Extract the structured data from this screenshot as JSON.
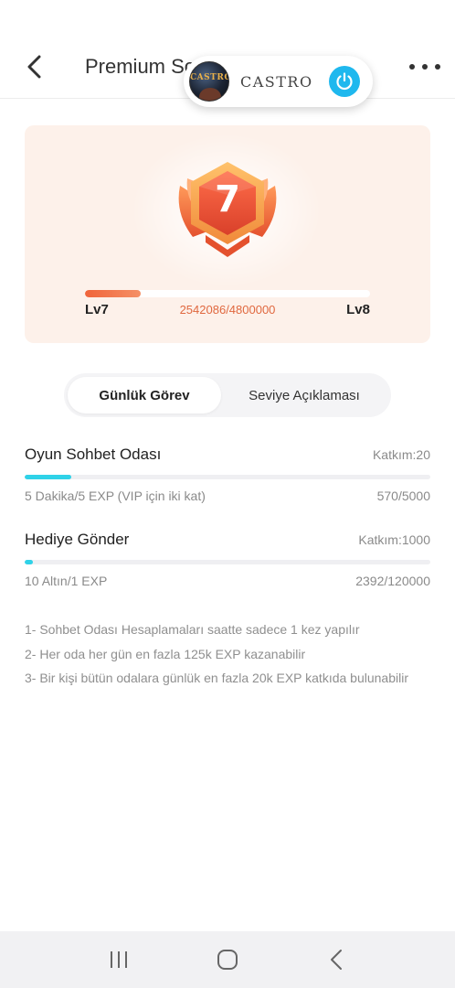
{
  "header": {
    "title": "Premium So",
    "overlay": {
      "brand": "CASTRO",
      "avatar_text": "CASTRO"
    }
  },
  "level_card": {
    "badge_level": "7",
    "current_level": "Lv7",
    "next_level": "Lv8",
    "progress_text": "2542086/4800000",
    "progress_fraction": 0.196,
    "accent_color": "#f0643a"
  },
  "tabs": [
    {
      "label": "Günlük Görev",
      "active": true
    },
    {
      "label": "Seviye Açıklaması",
      "active": false
    }
  ],
  "tasks": [
    {
      "title": "Oyun Sohbet Odası",
      "contribution": "Katkım:20",
      "description": "5 Dakika/5 EXP (VIP için iki kat)",
      "count": "570/5000",
      "progress_fraction": 0.114
    },
    {
      "title": "Hediye Gönder",
      "contribution": "Katkım:1000",
      "description": "10 Altın/1 EXP",
      "count": "2392/120000",
      "progress_fraction": 0.02
    }
  ],
  "notes": [
    "1- Sohbet Odası Hesaplamaları saatte sadece 1 kez yapılır",
    "2- Her oda her gün en fazla 125k EXP kazanabilir",
    "3- Bir kişi bütün odalara günlük en fazla 20k EXP katkıda bulunabilir"
  ],
  "colors": {
    "task_bar": "#2fd2e8",
    "power_button": "#1fb8ee",
    "card_background": "#fdf1ea"
  },
  "icons": {
    "back": "chevron-left-icon",
    "more": "more-horizontal-icon",
    "power": "power-icon",
    "nav_recents": "recents-icon",
    "nav_home": "home-icon",
    "nav_back": "back-icon"
  }
}
